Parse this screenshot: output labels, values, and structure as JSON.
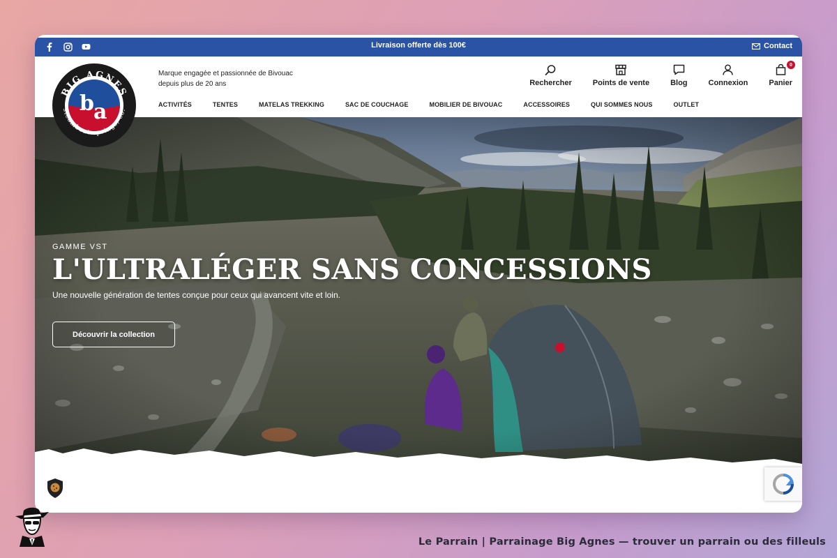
{
  "topbar": {
    "promo": "Livraison offerte dès 100€",
    "contact_label": "Contact",
    "socials": [
      "facebook-icon",
      "instagram-icon",
      "youtube-icon"
    ]
  },
  "header": {
    "tagline_line1": "Marque engagée et passionnée de Bivouac",
    "tagline_line2": "depuis plus de 20 ans",
    "logo_text_top": "BIG AGNES",
    "logo_text_bottom": "steamboat springs, co.",
    "actions": [
      {
        "label": "Rechercher",
        "icon": "search-icon"
      },
      {
        "label": "Points de vente",
        "icon": "store-icon"
      },
      {
        "label": "Blog",
        "icon": "chat-icon"
      },
      {
        "label": "Connexion",
        "icon": "user-icon"
      },
      {
        "label": "Panier",
        "icon": "bag-icon",
        "badge": "0"
      }
    ]
  },
  "nav": [
    "ACTIVITÉS",
    "TENTES",
    "MATELAS TREKKING",
    "SAC DE COUCHAGE",
    "MOBILIER DE BIVOUAC",
    "ACCESSOIRES",
    "QUI SOMMES NOUS",
    "OUTLET"
  ],
  "hero": {
    "kicker": "GAMME VST",
    "headline": "L'ULTRALÉGER SANS CONCESSIONS",
    "subtitle": "Une nouvelle génération de tentes conçue pour ceux qui avancent vite et loin.",
    "cta": "Découvrir la collection"
  },
  "caption": "Le Parrain | Parrainage Big Agnes — trouver un parrain ou des filleuls",
  "colors": {
    "topbar": "#2a52a5",
    "brand_red": "#c8102e",
    "brand_blue": "#1f4e9c"
  }
}
